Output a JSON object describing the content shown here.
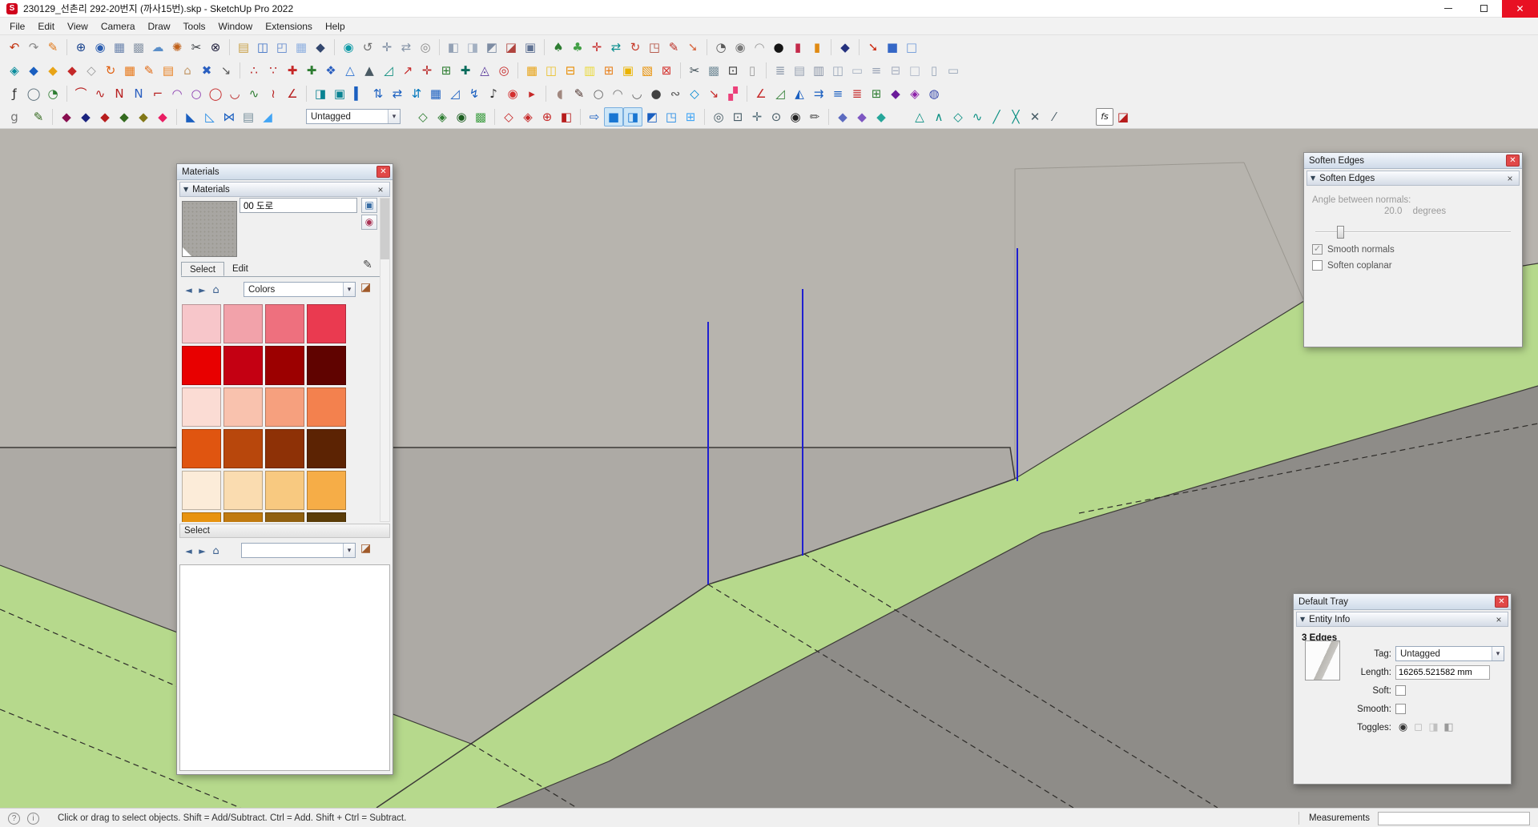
{
  "window": {
    "title": "230129_선촌리 292-20번지 (까사15번).skp - SketchUp Pro 2022",
    "close_glyph": "✕"
  },
  "menu": {
    "items": [
      "File",
      "Edit",
      "View",
      "Camera",
      "Draw",
      "Tools",
      "Window",
      "Extensions",
      "Help"
    ]
  },
  "toolbars": {
    "tag_value": "Untagged",
    "fs_label": "fs",
    "rows": [
      [
        {
          "g": "↶",
          "c": "#c23310",
          "n": "undo-icon"
        },
        {
          "g": "↷",
          "c": "#8a8a8a",
          "n": "redo-icon"
        },
        {
          "g": "✎",
          "c": "#e07818"
        },
        {
          "s": 1
        },
        {
          "g": "⊕",
          "c": "#16418c"
        },
        {
          "g": "◉",
          "c": "#2a5db0"
        },
        {
          "g": "▦",
          "c": "#6b84ad"
        },
        {
          "g": "▩",
          "c": "#8a97a8"
        },
        {
          "g": "☁",
          "c": "#5b8fc9"
        },
        {
          "g": "✺",
          "c": "#c06018"
        },
        {
          "g": "✂",
          "c": "#33383d"
        },
        {
          "g": "⊗",
          "c": "#23233f"
        },
        {
          "s": 1
        },
        {
          "g": "▤",
          "c": "#c9a24a"
        },
        {
          "g": "◫",
          "c": "#3b6fc4"
        },
        {
          "g": "◰",
          "c": "#5d86cc"
        },
        {
          "g": "▦",
          "c": "#8fb0e0"
        },
        {
          "g": "◆",
          "c": "#33476e"
        },
        {
          "s": 1
        },
        {
          "g": "◉",
          "c": "#0d9aa6",
          "n": "orbit-icon"
        },
        {
          "g": "↺",
          "c": "#6f6f6f"
        },
        {
          "g": "✛",
          "c": "#7a8aa0",
          "n": "pan-icon"
        },
        {
          "g": "⇄",
          "c": "#8795a8"
        },
        {
          "g": "◎",
          "c": "#8a8a8a",
          "n": "zoom-extents-icon"
        },
        {
          "s": 1
        },
        {
          "g": "◧",
          "c": "#93a1b5"
        },
        {
          "g": "◨",
          "c": "#a3b0c2"
        },
        {
          "g": "◩",
          "c": "#7d8ca3"
        },
        {
          "g": "◪",
          "c": "#b0443e"
        },
        {
          "g": "▣",
          "c": "#5f7293"
        },
        {
          "s": 1
        },
        {
          "g": "♠",
          "c": "#2e7d32"
        },
        {
          "g": "♣",
          "c": "#43a047"
        },
        {
          "g": "✛",
          "c": "#c62b2b",
          "n": "move-icon"
        },
        {
          "g": "⇄",
          "c": "#0a8f8f"
        },
        {
          "g": "↻",
          "c": "#c63b2b",
          "n": "rotate-icon"
        },
        {
          "g": "◳",
          "c": "#b04a3a"
        },
        {
          "g": "✎",
          "c": "#bb2c22"
        },
        {
          "g": "➘",
          "c": "#d86a44"
        },
        {
          "s": 1
        },
        {
          "g": "◔",
          "c": "#5a5a5a"
        },
        {
          "g": "◉",
          "c": "#7a7a7a"
        },
        {
          "g": "◠",
          "c": "#9a9a9a"
        },
        {
          "g": "●",
          "c": "#151515"
        },
        {
          "g": "▮",
          "c": "#c42a4a"
        },
        {
          "g": "▮",
          "c": "#e08a12"
        },
        {
          "s": 1
        },
        {
          "g": "◆",
          "c": "#24317e"
        },
        {
          "s": 1
        },
        {
          "g": "➘",
          "c": "#cc2a10"
        },
        {
          "g": "■",
          "c": "#3567c6"
        },
        {
          "g": "□",
          "c": "#6d98d8"
        }
      ],
      [
        {
          "g": "◈",
          "c": "#0a8c9c"
        },
        {
          "g": "◆",
          "c": "#1a5fc0"
        },
        {
          "g": "◆",
          "c": "#e8a418"
        },
        {
          "g": "◆",
          "c": "#c42828"
        },
        {
          "g": "◇",
          "c": "#9a9a9a"
        },
        {
          "g": "↻",
          "c": "#e06010"
        },
        {
          "g": "▦",
          "c": "#e87818"
        },
        {
          "g": "✎",
          "c": "#e06810"
        },
        {
          "g": "▤",
          "c": "#e88020"
        },
        {
          "g": "⌂",
          "c": "#c49a6c"
        },
        {
          "g": "✖",
          "c": "#2a5fc0"
        },
        {
          "g": "↘",
          "c": "#5a5a5a"
        },
        {
          "s": 1
        },
        {
          "g": "∴",
          "c": "#b71c1c"
        },
        {
          "g": "∵",
          "c": "#b71c1c"
        },
        {
          "g": "✚",
          "c": "#c62828"
        },
        {
          "g": "✚",
          "c": "#2e7d32"
        },
        {
          "g": "❖",
          "c": "#2a5fc0"
        },
        {
          "g": "△",
          "c": "#2a70d0"
        },
        {
          "g": "▲",
          "c": "#4a5a64"
        },
        {
          "g": "◿",
          "c": "#0a8c7c"
        },
        {
          "g": "↗",
          "c": "#c62828"
        },
        {
          "g": "✛",
          "c": "#b72020"
        },
        {
          "g": "⊞",
          "c": "#2e7d32"
        },
        {
          "g": "✚",
          "c": "#0a6c5c"
        },
        {
          "g": "◬",
          "c": "#5a3a9c"
        },
        {
          "g": "◎",
          "c": "#c62828"
        },
        {
          "s": 1
        },
        {
          "g": "▦",
          "c": "#e8a418"
        },
        {
          "g": "◫",
          "c": "#eac02c"
        },
        {
          "g": "⊟",
          "c": "#e88c00"
        },
        {
          "g": "▥",
          "c": "#ead835"
        },
        {
          "g": "⊞",
          "c": "#e8801c"
        },
        {
          "g": "▣",
          "c": "#eab300"
        },
        {
          "g": "▧",
          "c": "#e88f00"
        },
        {
          "g": "⊠",
          "c": "#d53935"
        },
        {
          "s": 1
        },
        {
          "g": "✂",
          "c": "#37474f"
        },
        {
          "g": "▩",
          "c": "#78909c"
        },
        {
          "g": "⊡",
          "c": "#3a3a3a"
        },
        {
          "g": "▯",
          "c": "#9a9a9a"
        },
        {
          "s": 1
        },
        {
          "g": "≣",
          "c": "#8a96a8"
        },
        {
          "g": "▤",
          "c": "#9aa4b4"
        },
        {
          "g": "▥",
          "c": "#8a94a6"
        },
        {
          "g": "◫",
          "c": "#9aa6b8"
        },
        {
          "g": "▭",
          "c": "#a8b2c2"
        },
        {
          "g": "≡",
          "c": "#98a2b4"
        },
        {
          "g": "⊟",
          "c": "#a8b0c0"
        },
        {
          "g": "□",
          "c": "#b0b8c8"
        },
        {
          "g": "▯",
          "c": "#9aa8ba"
        },
        {
          "g": "▭",
          "c": "#98a6b8"
        }
      ],
      [
        {
          "g": "ƒ",
          "c": "#2a2a2a"
        },
        {
          "g": "◯",
          "c": "#5a6e7a"
        },
        {
          "g": "◔",
          "c": "#2e7d32"
        },
        {
          "s": 1
        },
        {
          "g": "⌒",
          "c": "#b72020",
          "n": "arc-icon"
        },
        {
          "g": "∿",
          "c": "#b72020"
        },
        {
          "g": "N",
          "c": "#b72020"
        },
        {
          "g": "N",
          "c": "#2a5fc0"
        },
        {
          "g": "⌐",
          "c": "#b72020"
        },
        {
          "g": "◠",
          "c": "#8a3ab0"
        },
        {
          "g": "○",
          "c": "#8a3ab0"
        },
        {
          "g": "◯",
          "c": "#c62828",
          "n": "circle-icon"
        },
        {
          "g": "◡",
          "c": "#b72020"
        },
        {
          "g": "∿",
          "c": "#2e7d32"
        },
        {
          "g": "≀",
          "c": "#b72020"
        },
        {
          "g": "∠",
          "c": "#b72020"
        },
        {
          "s": 1
        },
        {
          "g": "◨",
          "c": "#0a8392"
        },
        {
          "g": "▣",
          "c": "#0a8392"
        },
        {
          "g": "▍",
          "c": "#1a5fc0"
        },
        {
          "g": "⇅",
          "c": "#1a5fc0"
        },
        {
          "g": "⇄",
          "c": "#1a5fc0"
        },
        {
          "g": "⇵",
          "c": "#0277bd"
        },
        {
          "g": "▦",
          "c": "#1a5fc0"
        },
        {
          "g": "◿",
          "c": "#1a5fc0"
        },
        {
          "g": "↯",
          "c": "#1a5fc0"
        },
        {
          "g": "♪",
          "c": "#333333"
        },
        {
          "g": "◉",
          "c": "#d32f2f"
        },
        {
          "g": "▸",
          "c": "#c62828"
        },
        {
          "s": 1
        },
        {
          "g": "◖",
          "c": "#a1887f"
        },
        {
          "g": "✎",
          "c": "#4e342e"
        },
        {
          "g": "○",
          "c": "#616161"
        },
        {
          "g": "◠",
          "c": "#757575"
        },
        {
          "g": "◡",
          "c": "#616161"
        },
        {
          "g": "●",
          "c": "#424242"
        },
        {
          "g": "∾",
          "c": "#555555"
        },
        {
          "g": "◇",
          "c": "#0288d1"
        },
        {
          "g": "↘",
          "c": "#c62828"
        },
        {
          "g": "▞",
          "c": "#ec407a"
        },
        {
          "s": 1
        },
        {
          "g": "∠",
          "c": "#c62828"
        },
        {
          "g": "◿",
          "c": "#2e7d32"
        },
        {
          "g": "◭",
          "c": "#1a5fc0"
        },
        {
          "g": "⇉",
          "c": "#1a5fc0"
        },
        {
          "g": "≡",
          "c": "#1a5fc0"
        },
        {
          "g": "≣",
          "c": "#c62828"
        },
        {
          "g": "⊞",
          "c": "#2e7d32"
        },
        {
          "g": "◆",
          "c": "#6a1b9a"
        },
        {
          "g": "◈",
          "c": "#8e24aa"
        },
        {
          "g": "◍",
          "c": "#3949ab"
        }
      ],
      [
        {
          "g": "g",
          "c": "#777777"
        },
        {
          "gap": 6
        },
        {
          "g": "✎",
          "c": "#33691e"
        },
        {
          "s": 1
        },
        {
          "g": "◆",
          "c": "#880e4f"
        },
        {
          "g": "◆",
          "c": "#1a237e"
        },
        {
          "g": "◆",
          "c": "#b71c1c"
        },
        {
          "g": "◆",
          "c": "#33691e"
        },
        {
          "g": "◆",
          "c": "#827717"
        },
        {
          "g": "◆",
          "c": "#e91e63"
        },
        {
          "s": 1
        },
        {
          "g": "◣",
          "c": "#1a5fc0"
        },
        {
          "g": "◺",
          "c": "#1e88e5"
        },
        {
          "g": "⋈",
          "c": "#1a5fc0"
        },
        {
          "g": "▤",
          "c": "#78909c"
        },
        {
          "g": "◢",
          "c": "#42a5f5"
        },
        {
          "gap": 36
        },
        {
          "dd": 1
        },
        {
          "gap": 16
        },
        {
          "g": "◇",
          "c": "#2e7d32"
        },
        {
          "g": "◈",
          "c": "#2e7d32"
        },
        {
          "g": "◉",
          "c": "#1b5e20"
        },
        {
          "g": "▩",
          "c": "#43a047"
        },
        {
          "s": 1
        },
        {
          "g": "◇",
          "c": "#c62828"
        },
        {
          "g": "◈",
          "c": "#c62828"
        },
        {
          "g": "⊕",
          "c": "#c62828"
        },
        {
          "g": "◧",
          "c": "#b71c1c"
        },
        {
          "s": 1
        },
        {
          "g": "⇨",
          "c": "#1a5fc0"
        },
        {
          "g": "■",
          "c": "#1976d2",
          "on": 1
        },
        {
          "g": "◨",
          "c": "#1976d2",
          "on": 1
        },
        {
          "g": "◩",
          "c": "#1a5fc0"
        },
        {
          "g": "◳",
          "c": "#1e88e5"
        },
        {
          "g": "⊞",
          "c": "#42a5f5"
        },
        {
          "s": 1
        },
        {
          "g": "◎",
          "c": "#455a64",
          "n": "zoom-icon"
        },
        {
          "g": "⊡",
          "c": "#455a64"
        },
        {
          "g": "✛",
          "c": "#546e7a"
        },
        {
          "g": "⊙",
          "c": "#455a64"
        },
        {
          "g": "◉",
          "c": "#222222",
          "n": "eye-icon"
        },
        {
          "g": "✏",
          "c": "#555555"
        },
        {
          "s": 1
        },
        {
          "g": "◆",
          "c": "#5c6bc0"
        },
        {
          "g": "◆",
          "c": "#7e57c2"
        },
        {
          "g": "◆",
          "c": "#26a69a"
        },
        {
          "gap": 24
        },
        {
          "g": "△",
          "c": "#0a8f82"
        },
        {
          "g": "∧",
          "c": "#0a8f82"
        },
        {
          "g": "◇",
          "c": "#0a8f82"
        },
        {
          "g": "∿",
          "c": "#0a8f82"
        },
        {
          "g": "╱",
          "c": "#0a8f82"
        },
        {
          "g": "╳",
          "c": "#0a8f82"
        },
        {
          "g": "✕",
          "c": "#455a64"
        },
        {
          "g": "⁄",
          "c": "#455a64"
        },
        {
          "gap": 40
        },
        {
          "fs": 1
        },
        {
          "g": "◪",
          "c": "#b71c1c",
          "n": "paint-bucket-icon"
        }
      ]
    ]
  },
  "viewport": {
    "colors": {
      "base": "#a3a09b",
      "slab": "#b7b4ae",
      "wall": "#adaaa5",
      "grass": "#b6d98c",
      "road": "#8e8c88",
      "edge": "#3c3a37",
      "dashed": "#2e2c29",
      "guide": "#1f1fd0",
      "faint": "#9b9891"
    }
  },
  "materials_panel": {
    "title": "Materials",
    "rollup_title": "Materials",
    "name_value": "00 도로",
    "tabs": [
      "Select",
      "Edit"
    ],
    "collection": "Colors",
    "secondary_header": "Select",
    "icons": {
      "back": "◄",
      "forward": "►",
      "home": "⌂",
      "secondary_pane": "▣",
      "create_material": "◉",
      "eyedropper": "✎",
      "sample_paint": "◪",
      "dropdown_arrow": "▾"
    },
    "swatches": [
      "#f7c6ca",
      "#f2a2aa",
      "#ee707e",
      "#ea3a50",
      "#e80000",
      "#c40012",
      "#9c0000",
      "#600300",
      "#fbdcd4",
      "#f9c2ae",
      "#f6a07e",
      "#f3814e",
      "#e05510",
      "#b8470c",
      "#8e3106",
      "#5c2303",
      "#fcecd9",
      "#fadcb0",
      "#f8c980",
      "#f6ad47",
      "#e89310",
      "#c07a10",
      "#906010",
      "#5a3c08"
    ]
  },
  "soften_panel": {
    "title": "Soften Edges",
    "rollup_title": "Soften Edges",
    "angle_label": "Angle between normals:",
    "angle_value": "20.0",
    "angle_unit": "degrees",
    "checkbox_smooth": "Smooth normals",
    "checkbox_coplanar": "Soften coplanar"
  },
  "tray_panel": {
    "title": "Default Tray",
    "rollup_title": "Entity Info",
    "selection": "3 Edges",
    "tag_label": "Tag:",
    "tag_value": "Untagged",
    "length_label": "Length:",
    "length_value": "16265.521582 mm",
    "soft_label": "Soft:",
    "smooth_label": "Smooth:",
    "toggles_label": "Toggles:",
    "toggles": [
      {
        "g": "◉",
        "c": "#333333",
        "n": "eye-toggle-icon"
      },
      {
        "g": "◻",
        "c": "#b8b8b8",
        "n": "lock-toggle-icon"
      },
      {
        "g": "◨",
        "c": "#c0c0c0",
        "n": "receive-shadows-toggle-icon"
      },
      {
        "g": "◧",
        "c": "#9a9a9a",
        "n": "cast-shadows-toggle-icon"
      }
    ]
  },
  "statusbar": {
    "help_glyph": "?",
    "info_glyph": "i",
    "hint": "Click or drag to select objects. Shift = Add/Subtract. Ctrl = Add. Shift + Ctrl = Subtract.",
    "measurements_label": "Measurements",
    "measurements_value": ""
  }
}
